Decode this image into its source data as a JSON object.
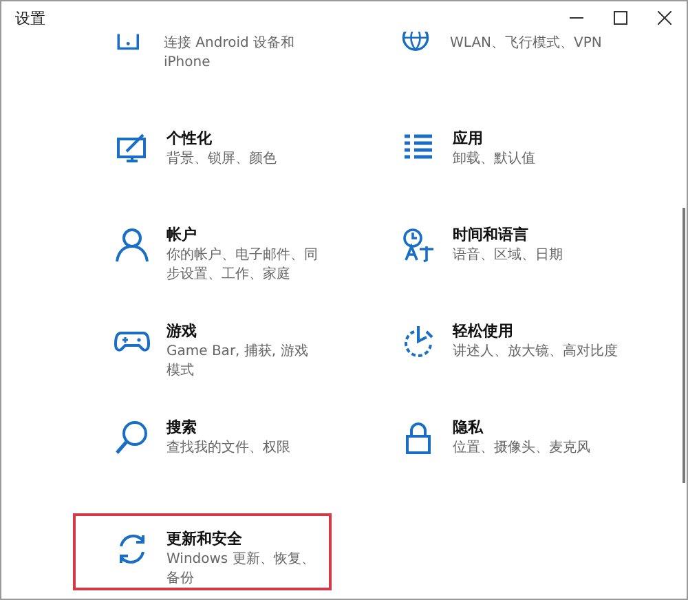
{
  "window": {
    "title": "设置"
  },
  "partial_row": [
    {
      "description": "连接 Android 设备和 iPhone"
    },
    {
      "description": "WLAN、飞行模式、VPN"
    }
  ],
  "tiles": [
    {
      "title": "个性化",
      "description": "背景、锁屏、颜色",
      "highlighted": false
    },
    {
      "title": "应用",
      "description": "卸载、默认值",
      "highlighted": false
    },
    {
      "title": "帐户",
      "description": "你的帐户、电子邮件、同步设置、工作、家庭",
      "highlighted": false
    },
    {
      "title": "时间和语言",
      "description": "语音、区域、日期",
      "highlighted": false
    },
    {
      "title": "游戏",
      "description": "Game Bar, 捕获, 游戏模式",
      "highlighted": false
    },
    {
      "title": "轻松使用",
      "description": "讲述人、放大镜、高对比度",
      "highlighted": false
    },
    {
      "title": "搜索",
      "description": "查找我的文件、权限",
      "highlighted": false
    },
    {
      "title": "隐私",
      "description": "位置、摄像头、麦克风",
      "highlighted": false
    },
    {
      "title": "更新和安全",
      "description": "Windows 更新、恢复、备份",
      "highlighted": true
    }
  ]
}
